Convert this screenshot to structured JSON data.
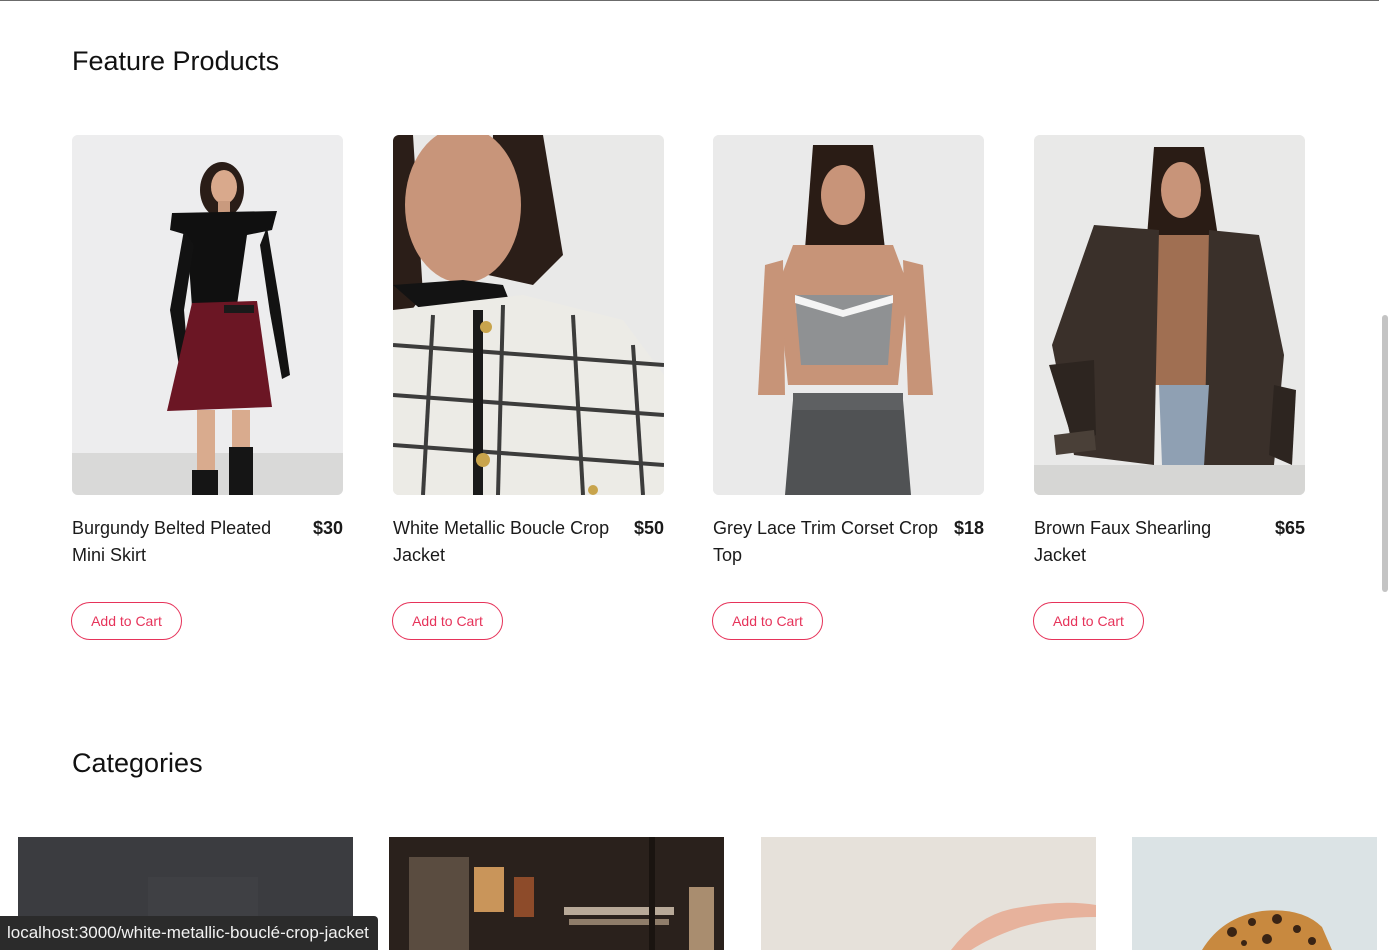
{
  "featured": {
    "title": "Feature Products",
    "products": [
      {
        "name": "Burgundy Belted Pleated Mini Skirt",
        "price": "$30",
        "button": "Add to Cart",
        "image": "model-black-top-burgundy-skirt"
      },
      {
        "name": "White Metallic Boucle Crop Jacket",
        "price": "$50",
        "button": "Add to Cart",
        "image": "model-white-boucle-jacket"
      },
      {
        "name": "Grey Lace Trim Corset Crop Top",
        "price": "$18",
        "button": "Add to Cart",
        "image": "model-grey-corset-top"
      },
      {
        "name": "Brown Faux Shearling Jacket",
        "price": "$65",
        "button": "Add to Cart",
        "image": "model-brown-shearling-jacket"
      }
    ]
  },
  "categories": {
    "title": "Categories",
    "items": [
      {
        "image": "dark-grey-category-image"
      },
      {
        "image": "store-interior-category-image"
      },
      {
        "image": "pale-studio-category-image"
      },
      {
        "image": "leopard-print-category-image"
      }
    ]
  },
  "status_bar": {
    "url": "localhost:3000/white-metallic-bouclé-crop-jacket"
  },
  "colors": {
    "accent": "#e6335a",
    "text": "#111111",
    "background": "#ffffff"
  }
}
